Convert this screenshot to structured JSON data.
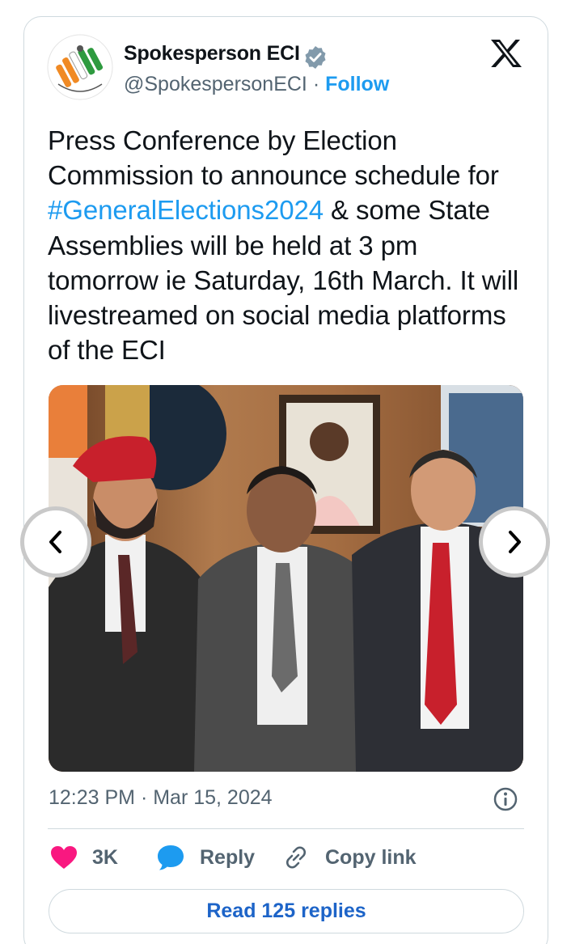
{
  "author": {
    "name": "Spokesperson ECI",
    "handle": "@SpokespersonECI",
    "separator": "·",
    "follow_label": "Follow",
    "verified": true,
    "avatar_icon": "eci-logo"
  },
  "tweet": {
    "text_before": "Press Conference by Election Commission to announce schedule for ",
    "hashtag": "#GeneralElections2024",
    "text_after": " &  some State Assemblies will be held at 3 pm tomorrow ie Saturday, 16th March. It will livestreamed on social media platforms of the ECI",
    "media": {
      "type": "photo",
      "description_icon": "photo-of-three-officials",
      "carousel": true
    },
    "timestamp": "12:23 PM · Mar 15, 2024"
  },
  "actions": {
    "like_count": "3K",
    "reply_label": "Reply",
    "copy_label": "Copy link",
    "read_replies_label": "Read 125 replies"
  },
  "colors": {
    "accent": "#1d9bf0",
    "like": "#f91880",
    "reply_icon": "#1d9bf0",
    "muted": "#536471"
  }
}
